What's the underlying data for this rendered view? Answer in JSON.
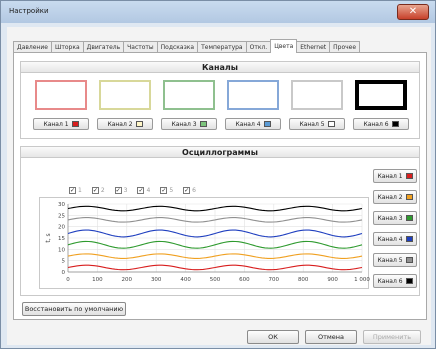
{
  "window": {
    "title": "Настройки",
    "close_label": "✕"
  },
  "tabs": [
    "Давление",
    "Шторка",
    "Двигатель",
    "Частоты",
    "Подсказка",
    "Температура",
    "Откл.",
    "Цвета",
    "Ethernet",
    "Прочее"
  ],
  "active_tab": "Цвета",
  "channels_group": {
    "title": "Каналы",
    "swatches": [
      {
        "border_color": "#e88a8a",
        "thick": false
      },
      {
        "border_color": "#d8d89a",
        "thick": false
      },
      {
        "border_color": "#8fc08f",
        "thick": false
      },
      {
        "border_color": "#86a8d8",
        "thick": false
      },
      {
        "border_color": "#c9c9c9",
        "thick": false
      },
      {
        "border_color": "#000000",
        "thick": true
      }
    ],
    "buttons": [
      {
        "label": "Канал 1",
        "color": "#d81e1e"
      },
      {
        "label": "Канал 2",
        "color": "#fff6c8"
      },
      {
        "label": "Канал 3",
        "color": "#7cc47c"
      },
      {
        "label": "Канал 4",
        "color": "#5b9bd5"
      },
      {
        "label": "Канал 5",
        "color": "#ffffff"
      },
      {
        "label": "Канал 6",
        "color": "#000000"
      }
    ]
  },
  "osc_group": {
    "title": "Осциллограммы",
    "checkboxes": [
      {
        "label": "1",
        "checked": true
      },
      {
        "label": "2",
        "checked": true
      },
      {
        "label": "3",
        "checked": true
      },
      {
        "label": "4",
        "checked": true
      },
      {
        "label": "5",
        "checked": true
      },
      {
        "label": "6",
        "checked": true
      }
    ],
    "buttons": [
      {
        "label": "Канал 1",
        "color": "#d81e1e"
      },
      {
        "label": "Канал 2",
        "color": "#f0a020"
      },
      {
        "label": "Канал 3",
        "color": "#2e9a2e"
      },
      {
        "label": "Канал 4",
        "color": "#1f3fbf"
      },
      {
        "label": "Канал 5",
        "color": "#909090"
      },
      {
        "label": "Канал 6",
        "color": "#000000"
      }
    ]
  },
  "chart_data": {
    "type": "line",
    "ylabel": "t, s",
    "xlim": [
      0,
      1000
    ],
    "ylim": [
      0,
      30
    ],
    "x_ticks": [
      "0",
      "100",
      "200",
      "300",
      "400",
      "500",
      "600",
      "700",
      "800",
      "900",
      "1 000"
    ],
    "y_ticks": [
      "0",
      "5",
      "10",
      "15",
      "20",
      "25",
      "30"
    ],
    "grid": true,
    "series": [
      {
        "color": "#d81e1e",
        "base": 2,
        "amp": 1
      },
      {
        "color": "#f0a020",
        "base": 7,
        "amp": 1
      },
      {
        "color": "#2e9a2e",
        "base": 12,
        "amp": 1.5
      },
      {
        "color": "#1f3fbf",
        "base": 17,
        "amp": 1.5
      },
      {
        "color": "#909090",
        "base": 23,
        "amp": 1
      },
      {
        "color": "#000000",
        "base": 28,
        "amp": 1
      }
    ]
  },
  "footer": {
    "defaults_label": "Восстановить по умолчанию",
    "ok_label": "ОК",
    "cancel_label": "Отмена",
    "apply_label": "Применить"
  }
}
